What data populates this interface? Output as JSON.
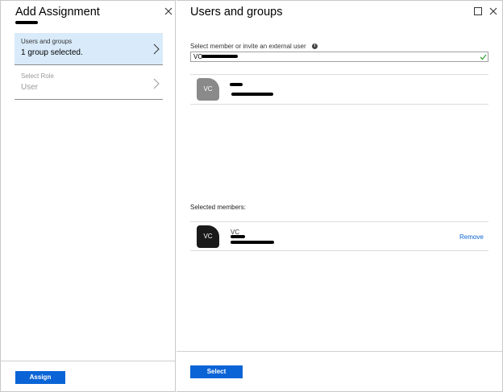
{
  "left_blade": {
    "title": "Add Assignment",
    "items": [
      {
        "label": "Users and groups",
        "value": "1 group selected.",
        "active": true
      },
      {
        "label": "Select Role",
        "value": "User",
        "active": false
      }
    ],
    "assign_label": "Assign"
  },
  "right_blade": {
    "title": "Users and groups",
    "search": {
      "label": "Select member or invite an external user",
      "value": "VC"
    },
    "result": {
      "initials": "VC"
    },
    "selected_label": "Selected members:",
    "selected_member": {
      "initials": "VC",
      "name_prefix": "VC",
      "remove_label": "Remove"
    },
    "select_label": "Select"
  },
  "colors": {
    "accent": "#0a64d6",
    "active_item_bg": "#d9ebfa",
    "avatar_gray": "#8a8a8a",
    "avatar_dark": "#1a1a1a",
    "check_green": "#3aa53a"
  },
  "icons": [
    "close-icon",
    "maximize-icon",
    "chevron-right-icon",
    "info-icon",
    "checkmark-icon"
  ]
}
